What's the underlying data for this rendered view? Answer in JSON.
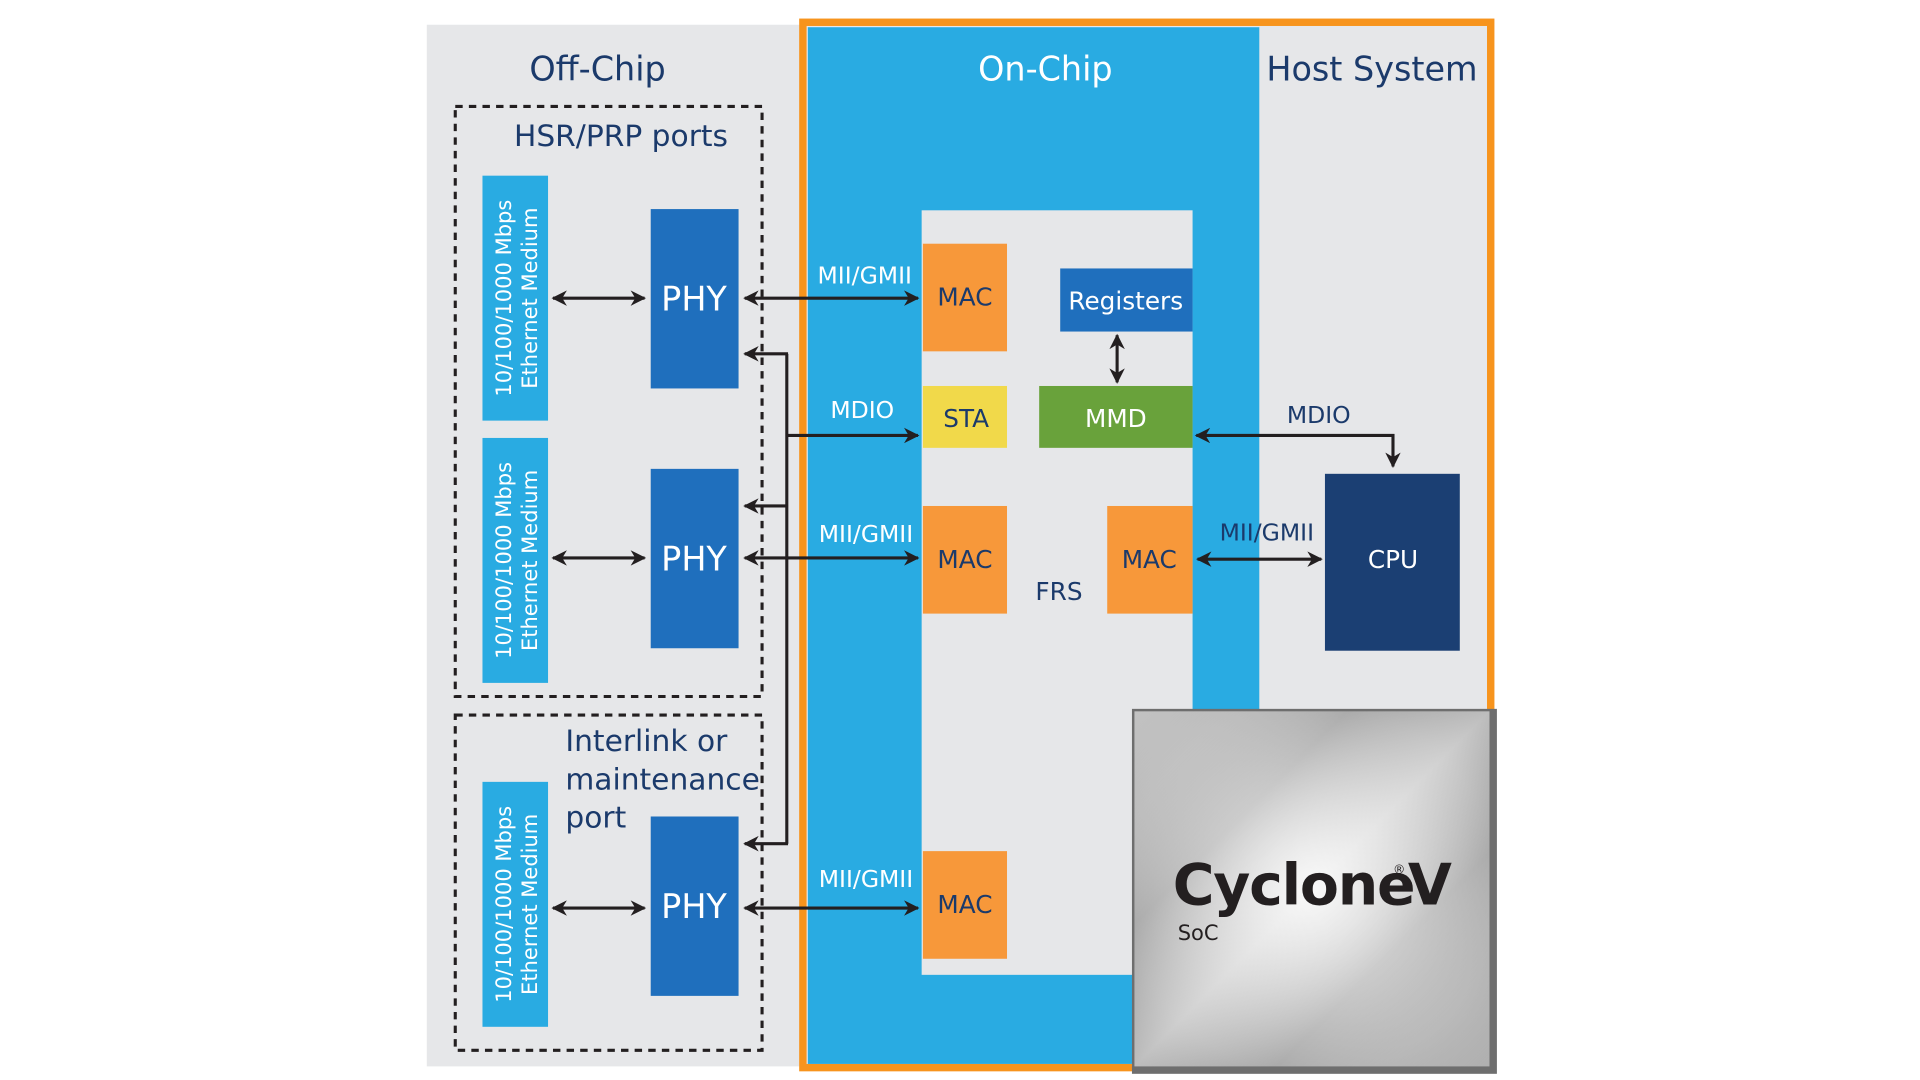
{
  "regions": {
    "off_chip": "Off-Chip",
    "on_chip": "On-Chip",
    "host_system": "Host System"
  },
  "groups": {
    "hsr_prp": "HSR/PRP ports",
    "interlink": [
      "Interlink or",
      "maintenance",
      "port"
    ]
  },
  "ethernet_medium": {
    "line1": "10/100/1000 Mbps",
    "line2": "Ethernet Medium"
  },
  "blocks": {
    "phy": "PHY",
    "mac": "MAC",
    "sta": "STA",
    "registers": "Registers",
    "mmd": "MMD",
    "frs": "FRS",
    "cpu": "CPU"
  },
  "links": {
    "mii_gmii": "MII/GMII",
    "mdio": "MDIO"
  },
  "chip_logo": {
    "name": "Cyclone",
    "registered": "®",
    "version": "V",
    "sub": "SoC"
  },
  "colors": {
    "orange_border": "#f7941d",
    "on_chip_blue": "#29abe2",
    "phy_blue": "#1f6fbd",
    "mac_orange": "#f7983a",
    "sta_yellow": "#f1d94a",
    "mmd_green": "#69a23b",
    "cpu_navy": "#1b3f73",
    "panel_grey": "#e6e7e9"
  }
}
